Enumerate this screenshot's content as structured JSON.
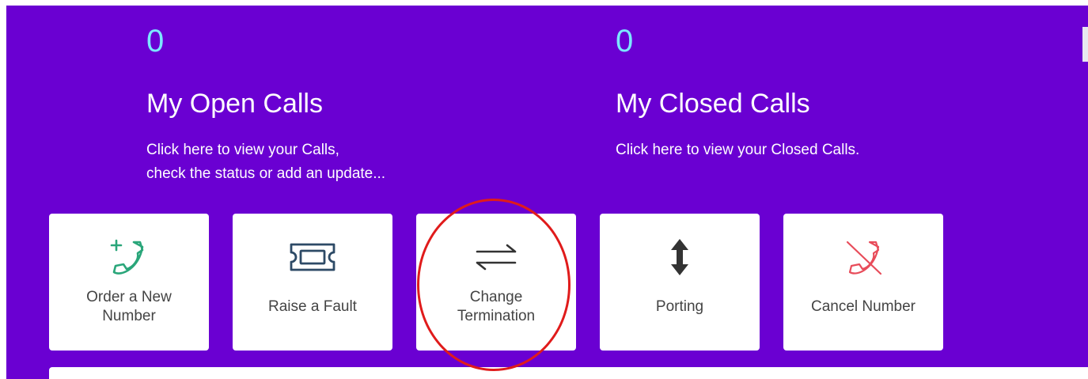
{
  "stats": {
    "open": {
      "count": "0",
      "title": "My Open Calls",
      "desc_line1": "Click here to view your Calls,",
      "desc_line2": "check the status or add an update..."
    },
    "closed": {
      "count": "0",
      "title": "My Closed Calls",
      "desc_line1": "Click here to view your Closed Calls."
    }
  },
  "tiles": [
    {
      "label": "Order a New\nNumber",
      "icon": "phone-plus-icon",
      "color": "#2aa67a"
    },
    {
      "label": "Raise a Fault",
      "icon": "ticket-icon",
      "color": "#2d4a66"
    },
    {
      "label": "Change\nTermination",
      "icon": "swap-arrows-icon",
      "color": "#333333"
    },
    {
      "label": "Porting",
      "icon": "vertical-arrows-icon",
      "color": "#333333"
    },
    {
      "label": "Cancel Number",
      "icon": "phone-slash-icon",
      "color": "#e84c5a"
    }
  ],
  "colors": {
    "banner": "#6a00d2",
    "count": "#7be7ff",
    "annotation": "#e01b1b"
  }
}
